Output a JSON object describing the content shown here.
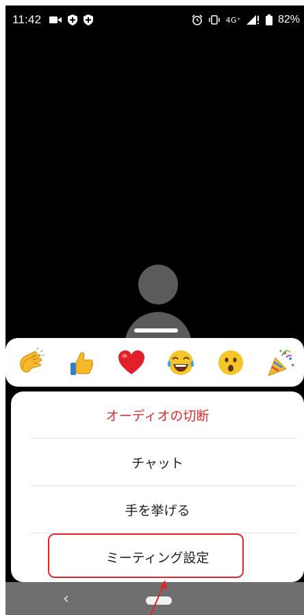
{
  "status": {
    "time": "11:42",
    "network": "4G⁺",
    "battery": "82%"
  },
  "reactions": [
    {
      "icon": "clapping-hands-icon",
      "glyph": "👏"
    },
    {
      "icon": "thumbs-up-icon",
      "glyph": "👍"
    },
    {
      "icon": "heart-icon",
      "glyph": "❤️"
    },
    {
      "icon": "tears-of-joy-icon",
      "glyph": "😂"
    },
    {
      "icon": "surprised-face-icon",
      "glyph": "😮"
    },
    {
      "icon": "party-popper-icon",
      "glyph": "🎉"
    }
  ],
  "menu": {
    "disconnect_audio": "オーディオの切断",
    "chat": "チャット",
    "raise_hand": "手を挙げる",
    "meeting_settings": "ミーティング設定"
  },
  "colors": {
    "danger_text": "#e02b2b",
    "highlight": "#e3242b"
  }
}
